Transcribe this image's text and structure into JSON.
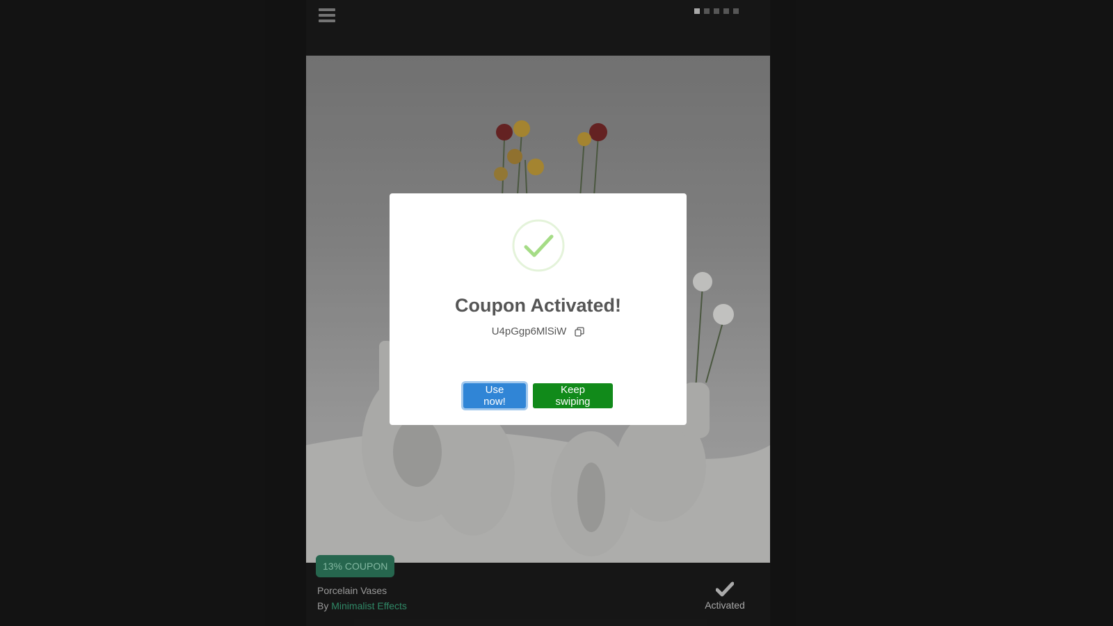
{
  "header": {
    "menu_icon": "hamburger-menu-icon",
    "pager": {
      "count": 5,
      "active_index": 0
    }
  },
  "product": {
    "badge": "13% COUPON",
    "title": "Porcelain Vases",
    "by_prefix": "By",
    "seller": "Minimalist Effects",
    "status_icon": "checkmark-icon",
    "status_label": "Activated"
  },
  "modal": {
    "icon": "success-check-icon",
    "title": "Coupon Activated!",
    "coupon_code": "U4pGgp6MlSiW",
    "copy_icon": "copy-icon",
    "primary_button": "Use now!",
    "secondary_button": "Keep swiping"
  },
  "colors": {
    "badge_bg": "#2f7d60",
    "badge_text": "#9fe0c4",
    "seller_link": "#3aa77d",
    "primary_button": "#3085d6",
    "secondary_button": "#118a1a",
    "success_check": "#a5dc86"
  }
}
